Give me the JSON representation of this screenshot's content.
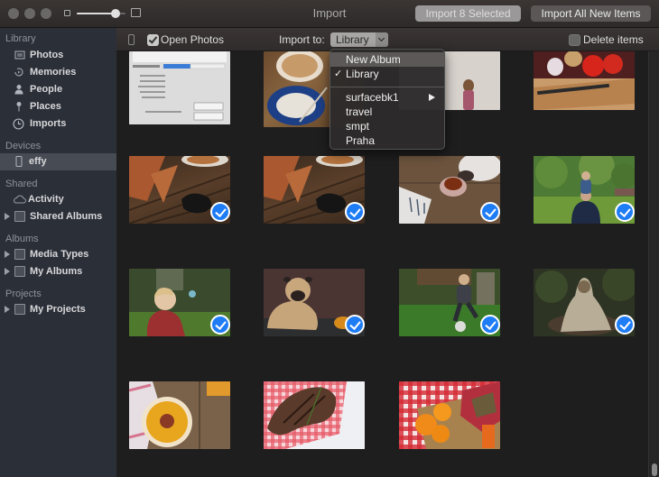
{
  "window": {
    "title": "Import",
    "import_selected_label": "Import 8 Selected",
    "import_all_label": "Import All New Items",
    "zoom_level": 0.8
  },
  "sidebar": {
    "sections": [
      {
        "heading": "Library",
        "items": [
          {
            "label": "Photos",
            "icon": "photos-icon"
          },
          {
            "label": "Memories",
            "icon": "memories-icon"
          },
          {
            "label": "People",
            "icon": "people-icon"
          },
          {
            "label": "Places",
            "icon": "places-icon"
          },
          {
            "label": "Imports",
            "icon": "imports-icon"
          }
        ]
      },
      {
        "heading": "Devices",
        "items": [
          {
            "label": "effy",
            "icon": "iphone-icon",
            "selected": true
          }
        ]
      },
      {
        "heading": "Shared",
        "items": [
          {
            "label": "Activity",
            "icon": "cloud-icon"
          },
          {
            "label": "Shared Albums",
            "icon": "album-stack-icon",
            "expandable": true
          }
        ]
      },
      {
        "heading": "Albums",
        "items": [
          {
            "label": "Media Types",
            "icon": "album-stack-icon",
            "expandable": true
          },
          {
            "label": "My Albums",
            "icon": "album-stack-icon",
            "expandable": true
          }
        ]
      },
      {
        "heading": "Projects",
        "items": [
          {
            "label": "My Projects",
            "icon": "album-stack-icon",
            "expandable": true
          }
        ]
      }
    ]
  },
  "toolbar": {
    "open_photos_label": "Open Photos",
    "open_photos_checked": true,
    "import_to_label": "Import to:",
    "import_to_value": "Library",
    "delete_items_label": "Delete items",
    "delete_items_checked": false
  },
  "import_menu": {
    "items": [
      {
        "label": "New Album",
        "highlighted": true
      },
      {
        "label": "Library",
        "checked": true
      },
      {
        "label": "surfacebk1",
        "submenu": true
      },
      {
        "label": "travel"
      },
      {
        "label": "smpt"
      },
      {
        "label": "Praha"
      }
    ]
  },
  "photos": [
    {
      "subject": "import progress screenshot",
      "selected": false
    },
    {
      "subject": "cappuccino cup",
      "selected": false
    },
    {
      "subject": "girl at wall",
      "selected": false
    },
    {
      "subject": "tomatoes on board",
      "selected": false
    },
    {
      "subject": "pizza and controller",
      "selected": true
    },
    {
      "subject": "pizza and controller",
      "selected": true
    },
    {
      "subject": "cat and tea",
      "selected": true
    },
    {
      "subject": "child in park",
      "selected": true
    },
    {
      "subject": "toddler with bubbles",
      "selected": true
    },
    {
      "subject": "pug with pumpkin",
      "selected": true
    },
    {
      "subject": "boy playing soccer",
      "selected": true
    },
    {
      "subject": "pug in blanket",
      "selected": true
    },
    {
      "subject": "pumpkin soup",
      "selected": false
    },
    {
      "subject": "grilled steak",
      "selected": false
    },
    {
      "subject": "watermelon and oranges",
      "selected": false
    }
  ],
  "colors": {
    "accent": "#1e7cf5",
    "sidebar_bg": "#2b2f38",
    "grid_bg": "#1e1e1e"
  }
}
